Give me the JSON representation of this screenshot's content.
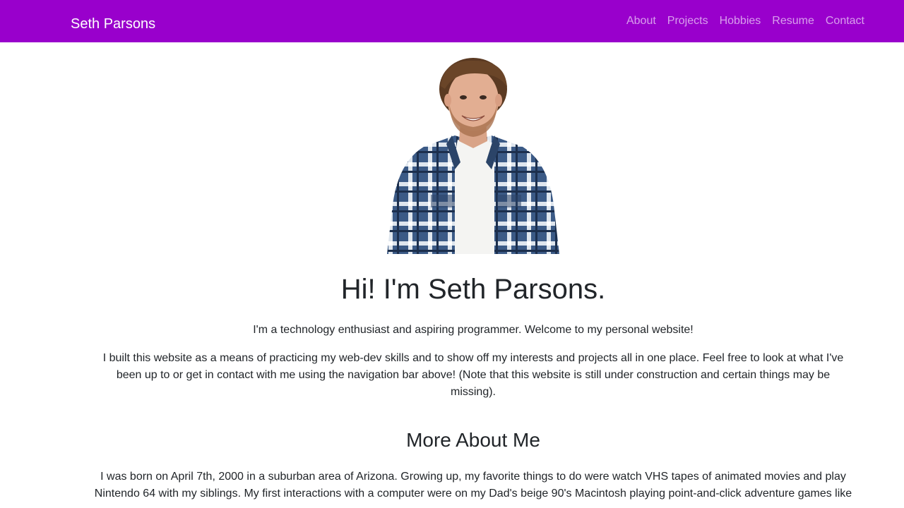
{
  "navbar": {
    "brand": "Seth Parsons",
    "links": [
      "About",
      "Projects",
      "Hobbies",
      "Resume",
      "Contact"
    ],
    "background_color": "#9900cc"
  },
  "hero": {
    "heading": "Hi! I'm Seth Parsons.",
    "intro": "I'm a technology enthusiast and aspiring programmer. Welcome to my personal website!",
    "description": "I built this website as a means of practicing my web-dev skills and to show off my interests and projects all in one place. Feel free to look at what I've been up to or get in contact with me using the navigation bar above! (Note that this website is still under construction and certain things may be missing)."
  },
  "about": {
    "heading": "More About Me",
    "text": "I was born on April 7th, 2000 in a suburban area of Arizona. Growing up, my favorite things to do were watch VHS tapes of animated movies and play Nintendo 64 with my siblings. My first interactions with a computer were on my Dad's beige 90's Macintosh playing point-and-click adventure games like"
  }
}
